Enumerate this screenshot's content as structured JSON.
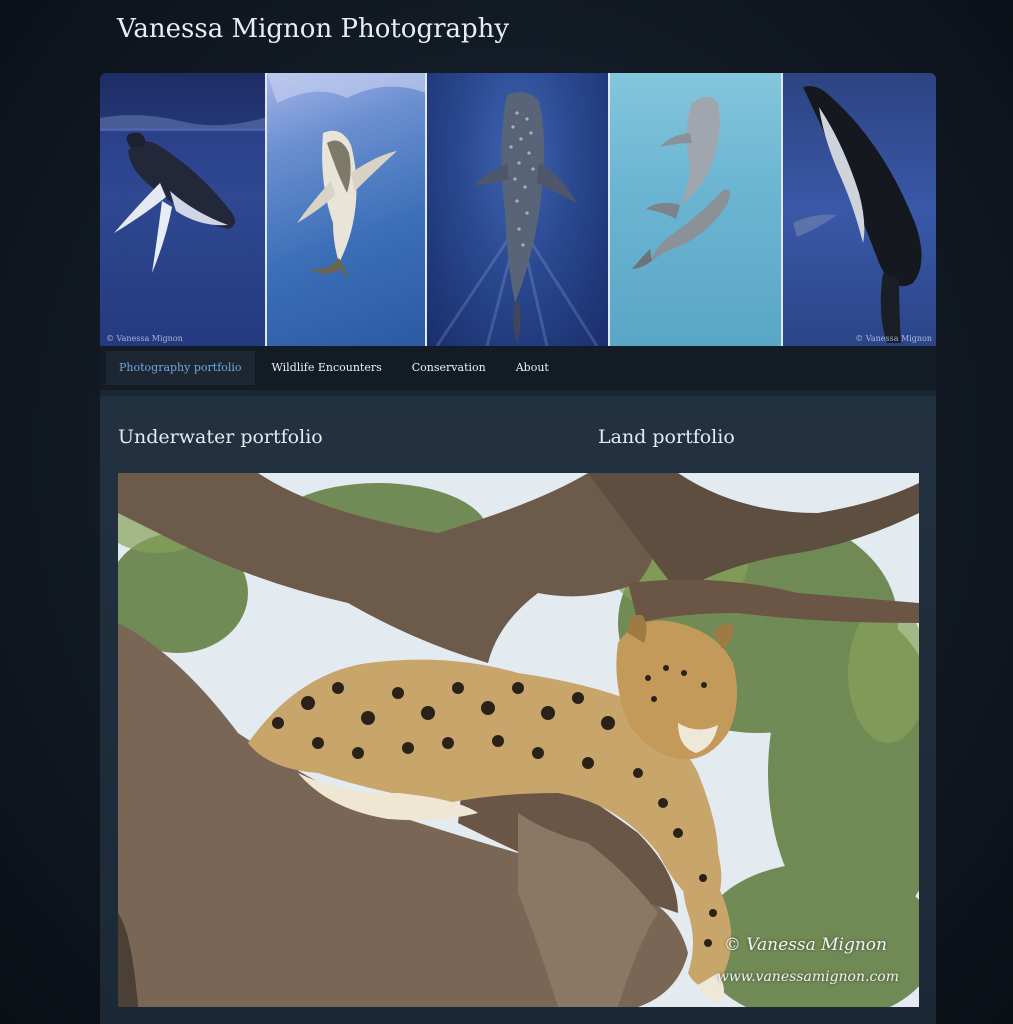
{
  "site": {
    "title": "Vanessa Mignon Photography"
  },
  "banner": {
    "panels": [
      {
        "icon": "humpback-whale-icon",
        "watermark": "© Vanessa Mignon"
      },
      {
        "icon": "shark-icon",
        "watermark": ""
      },
      {
        "icon": "whale-shark-icon",
        "watermark": ""
      },
      {
        "icon": "dolphins-icon",
        "watermark": ""
      },
      {
        "icon": "humpback-whale-icon",
        "watermark": "© Vanessa Mignon"
      }
    ]
  },
  "nav": {
    "items": [
      {
        "label": "Photography portfolio",
        "active": true
      },
      {
        "label": "Wildlife Encounters",
        "active": false
      },
      {
        "label": "Conservation",
        "active": false
      },
      {
        "label": "About",
        "active": false
      }
    ],
    "active_color": "#6fa6e0"
  },
  "main": {
    "underwater_heading": "Underwater portfolio",
    "land_heading": "Land portfolio",
    "photo": {
      "subject": "leopard-icon",
      "signature": "© Vanessa Mignon",
      "url": "www.vanessamignon.com"
    }
  }
}
